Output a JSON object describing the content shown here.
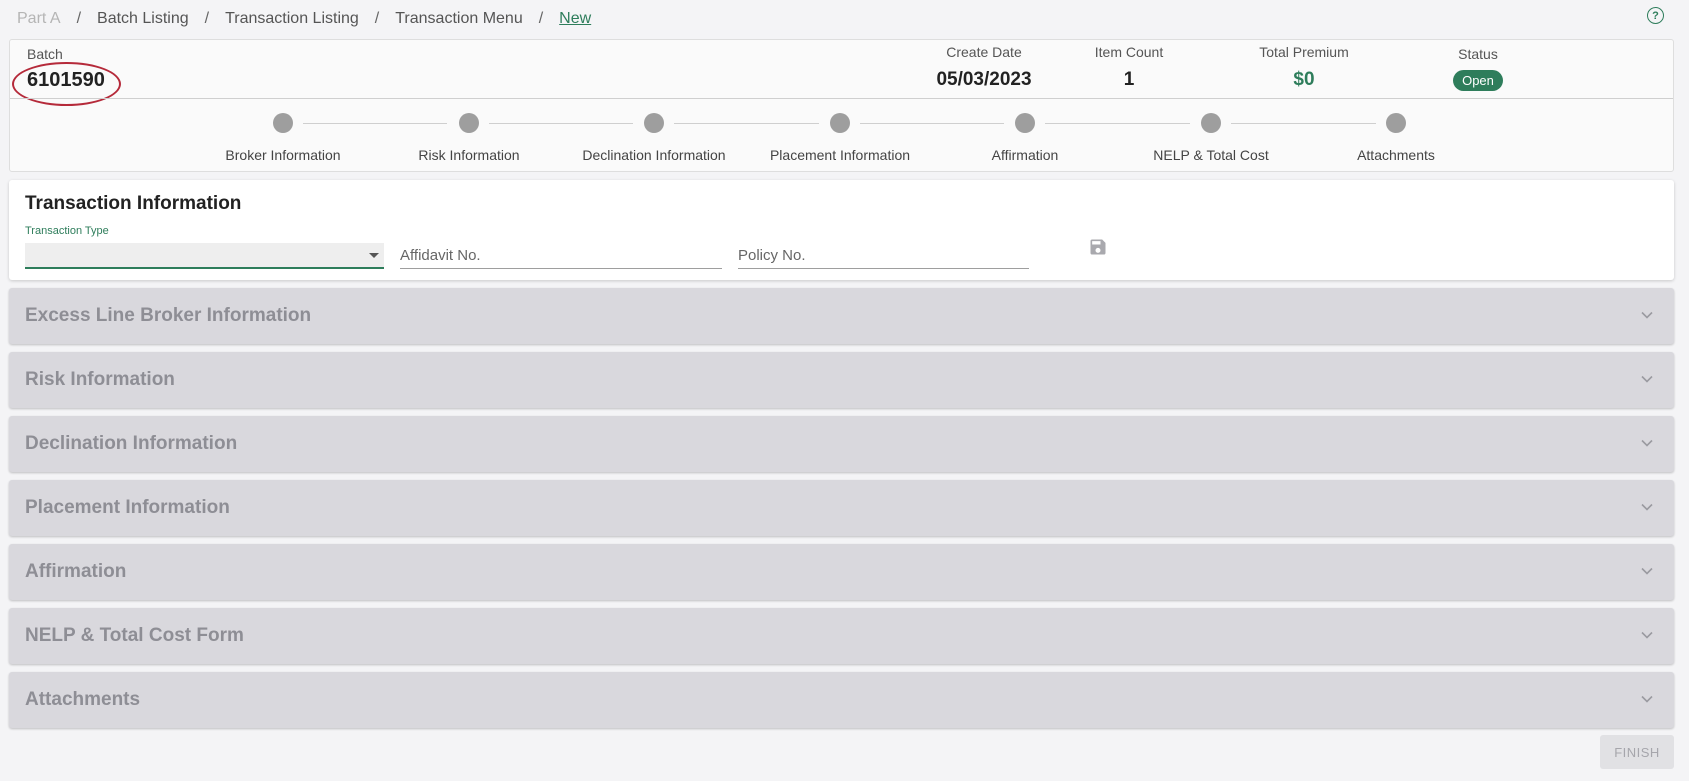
{
  "breadcrumb": {
    "items": [
      "Part A",
      "Batch Listing",
      "Transaction Listing",
      "Transaction Menu",
      "New"
    ],
    "separator": "/"
  },
  "help_icon": "question-circle-icon",
  "batch": {
    "label": "Batch",
    "id": "6101590",
    "create_date": {
      "label": "Create Date",
      "value": "05/03/2023"
    },
    "item_count": {
      "label": "Item Count",
      "value": "1"
    },
    "total_premium": {
      "label": "Total Premium",
      "value": "$0"
    },
    "status": {
      "label": "Status",
      "value": "Open"
    }
  },
  "steps": [
    "Broker Information",
    "Risk Information",
    "Declination Information",
    "Placement Information",
    "Affirmation",
    "NELP & Total Cost",
    "Attachments"
  ],
  "transaction": {
    "title": "Transaction Information",
    "type_label": "Transaction Type",
    "type_value": "",
    "affidavit_placeholder": "Affidavit No.",
    "policy_placeholder": "Policy No.",
    "save_icon": "save-icon"
  },
  "panels": [
    "Excess Line Broker Information",
    "Risk Information",
    "Declination Information",
    "Placement Information",
    "Affirmation",
    "NELP & Total Cost Form",
    "Attachments"
  ],
  "finish_label": "FINISH",
  "colors": {
    "accent": "#2e7d5b",
    "annotation": "#b52a3a",
    "panel_bg": "#d9d8dd"
  }
}
